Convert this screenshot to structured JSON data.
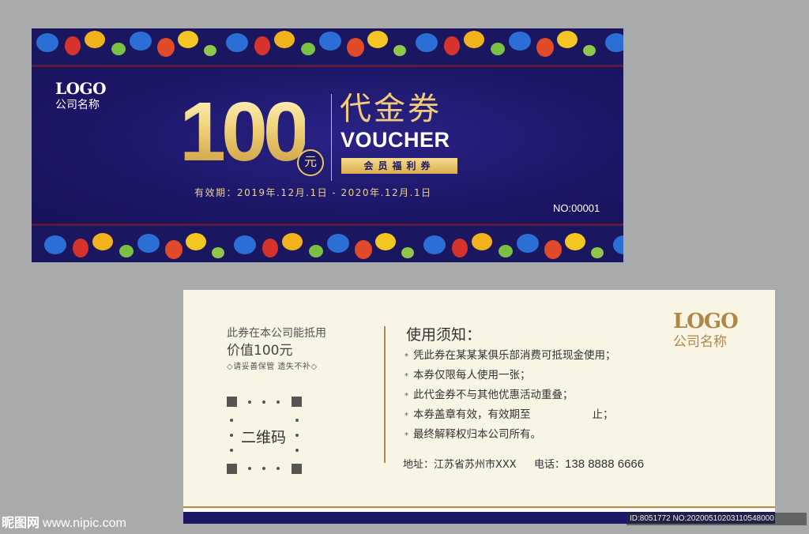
{
  "front": {
    "logo": "LOGO",
    "company": "公司名称",
    "amount": "100",
    "currency": "元",
    "title_cn": "代金券",
    "title_en": "VOUCHER",
    "tag": "会员福利券",
    "validity": "有效期：2019年.12月.1日 - 2020年.12月.1日",
    "serial": "NO:00001",
    "colors": {
      "navy": "#1d1768",
      "gold": "#f0cc7a"
    }
  },
  "back": {
    "redeem_line1": "此券在本公司能抵用",
    "redeem_line2": "价值100元",
    "keep_note": "◇请妥善保管 遗失不补◇",
    "qr_label": "二维码",
    "rules_title": "使用须知：",
    "rules": [
      "凭此券在某某某俱乐部消费可抵现金使用；",
      "本券仅限每人使用一张；",
      "此代金券不与其他优惠活动重叠；",
      "本券盖章有效，有效期至",
      "最终解释权归本公司所有。"
    ],
    "rule4_end": "止；",
    "address": "地址：江苏省苏州市XXX",
    "phone_label": "电话：",
    "phone": "138 8888 6666",
    "logo": "LOGO",
    "company": "公司名称",
    "bullet": "*"
  },
  "watermark": {
    "site_name": "昵图网",
    "site_url": "www.nipic.com",
    "image_id": "ID:8051772 NO:20200510203110548000"
  }
}
